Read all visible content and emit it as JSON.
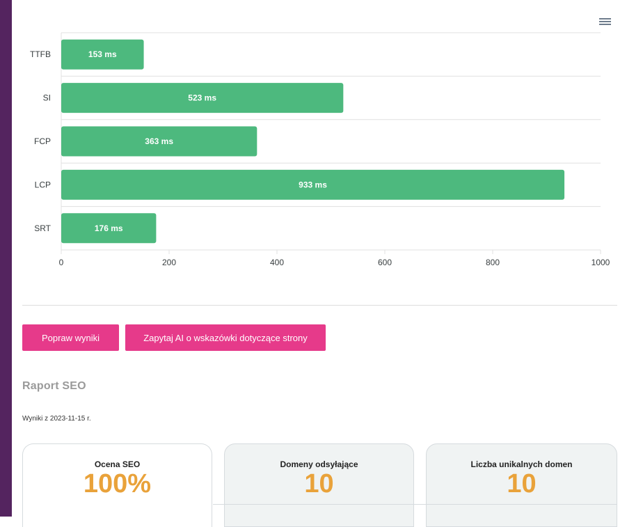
{
  "colors": {
    "sidebar": "#54245f",
    "bar": "#4db97e",
    "button": "#e63a8a",
    "metric_value": "#e9a23a"
  },
  "chart_menu_icon": "hamburger-menu-icon",
  "chart_data": {
    "type": "bar",
    "orientation": "horizontal",
    "categories": [
      "TTFB",
      "SI",
      "FCP",
      "LCP",
      "SRT"
    ],
    "values": [
      153,
      523,
      363,
      933,
      176
    ],
    "data_labels": [
      "153 ms",
      "523 ms",
      "363 ms",
      "933 ms",
      "176 ms"
    ],
    "xlim": [
      0,
      1000
    ],
    "xticks": [
      "0",
      "200",
      "400",
      "600",
      "800",
      "1000"
    ],
    "grid": true,
    "title": "",
    "xlabel": "",
    "ylabel": ""
  },
  "actions": {
    "improve_label": "Popraw wyniki",
    "ask_ai_label": "Zapytaj AI o wskazówki dotyczące strony"
  },
  "seo": {
    "title": "Raport SEO",
    "date": "Wyniki z 2023-11-15 r.",
    "cards": [
      {
        "label": "Ocena SEO",
        "value": "100%"
      },
      {
        "label": "Domeny odsyłające",
        "value": "10"
      },
      {
        "label": "Liczba unikalnych domen",
        "value": "10"
      }
    ]
  }
}
